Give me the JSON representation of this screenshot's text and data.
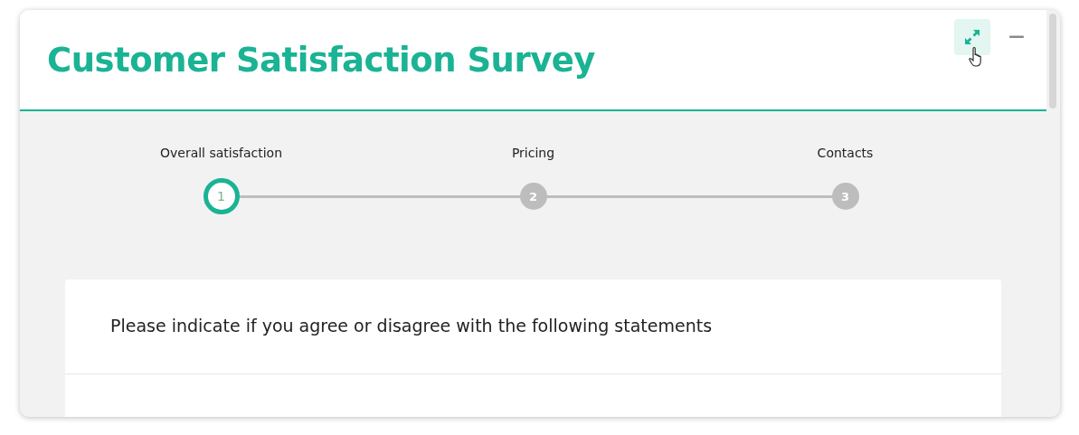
{
  "title": "Customer Satisfaction Survey",
  "steps": [
    {
      "label": "Overall satisfaction",
      "number": "1",
      "selected": true
    },
    {
      "label": "Pricing",
      "number": "2",
      "selected": false
    },
    {
      "label": "Contacts",
      "number": "3",
      "selected": false
    }
  ],
  "question": "Please indicate if you agree or disagree with the following statements"
}
